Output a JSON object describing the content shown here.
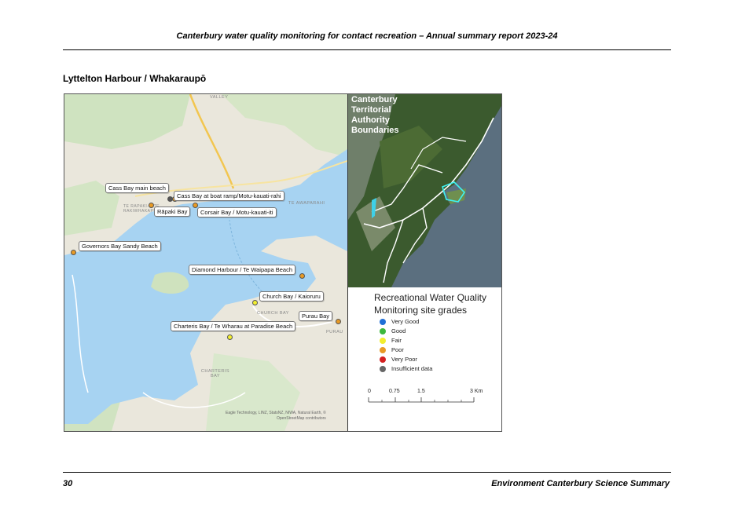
{
  "header": {
    "title": "Canterbury water quality monitoring for contact recreation – Annual summary report 2023-24"
  },
  "section": {
    "heading": "Lyttelton Harbour / Whakaraupō"
  },
  "map": {
    "place_names": [
      "TE AWAPARAHI",
      "CHURCH BAY",
      "PURAU",
      "CHARTERIS BAY",
      "TE RAPAKI-O TE RAKIWHAKAPUTA",
      "VALLEY"
    ],
    "sites": [
      {
        "label": "Cass Bay main beach",
        "grade": "Insufficient data"
      },
      {
        "label": "Cass Bay at boat ramp/Motu-kauati-rahi",
        "grade": "Poor"
      },
      {
        "label": "Rāpaki Bay",
        "grade": "Poor"
      },
      {
        "label": "Corsair Bay / Motu-kauati-iti",
        "grade": "Poor"
      },
      {
        "label": "Governors Bay Sandy Beach",
        "grade": "Poor"
      },
      {
        "label": "Diamond Harbour / Te Waipapa Beach",
        "grade": "Poor"
      },
      {
        "label": "Church Bay / Kaioruru",
        "grade": "Fair"
      },
      {
        "label": "Purau Bay",
        "grade": "Poor"
      },
      {
        "label": "Charteris Bay / Te Wharau at Paradise Beach",
        "grade": "Fair"
      }
    ],
    "attribution_line1": "Eagle Technology, LINZ, StatsNZ, NIWA, Natural Earth, ©",
    "attribution_line2": "OpenStreetMap contributors"
  },
  "inset": {
    "title_lines": [
      "Canterbury",
      "Territorial",
      "Authority",
      "Boundaries"
    ]
  },
  "legend": {
    "title_line1": "Recreational Water Quality",
    "title_line2": "Monitoring site grades",
    "items": [
      {
        "label": "Very Good",
        "color": "#1f6fd6"
      },
      {
        "label": "Good",
        "color": "#3cb83c"
      },
      {
        "label": "Fair",
        "color": "#f2ee2e"
      },
      {
        "label": "Poor",
        "color": "#e89a25"
      },
      {
        "label": "Very Poor",
        "color": "#d42020"
      },
      {
        "label": "Insufficient data",
        "color": "#666666"
      }
    ],
    "scale": {
      "ticks": [
        "0",
        "0.75",
        "1.5",
        "3 Km"
      ]
    }
  },
  "footer": {
    "page_number": "30",
    "publication": "Environment Canterbury Science Summary"
  }
}
